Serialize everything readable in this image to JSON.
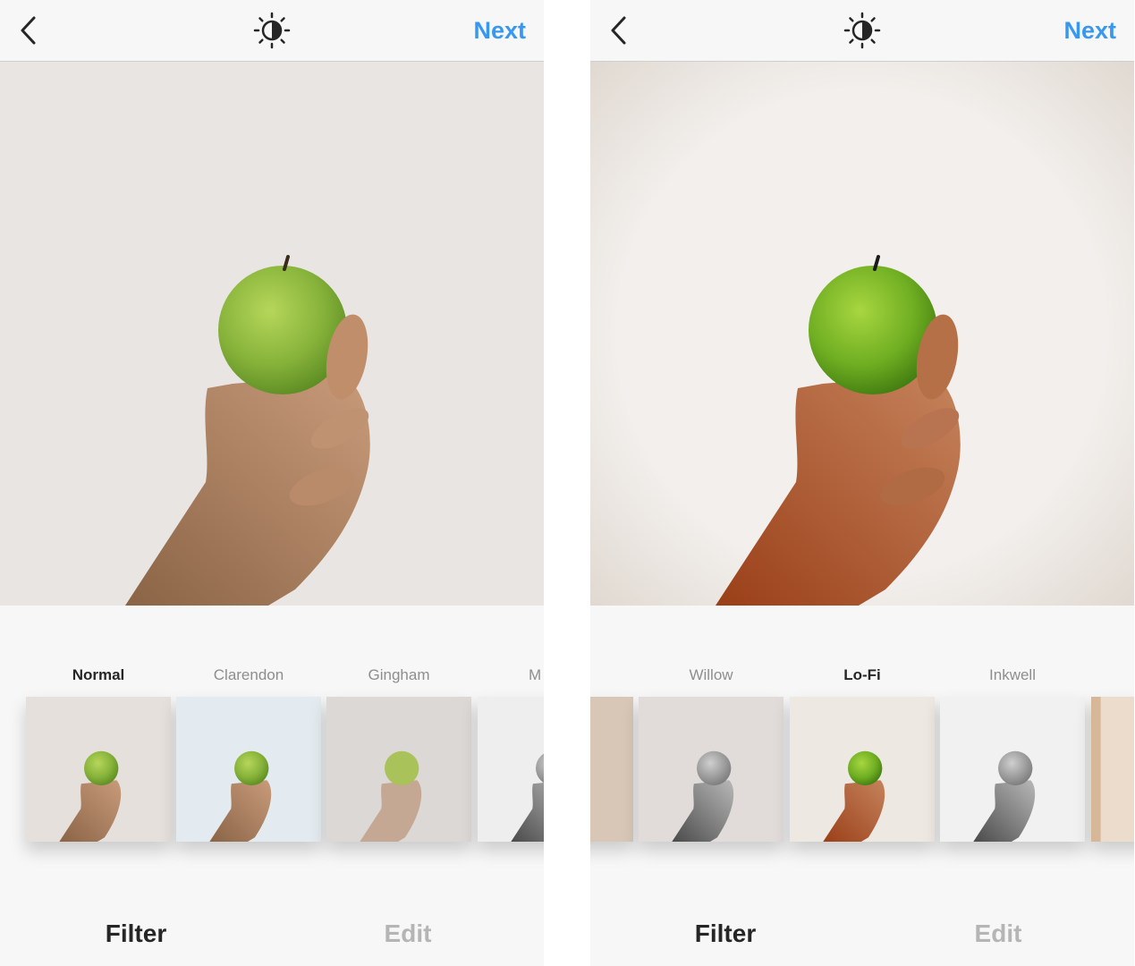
{
  "screens": [
    {
      "header": {
        "back_icon": "chevron-left-icon",
        "lux_icon": "lux-sun-icon",
        "next_label": "Next"
      },
      "filters": [
        {
          "label": "Normal",
          "active": true
        },
        {
          "label": "Clarendon",
          "active": false
        },
        {
          "label": "Gingham",
          "active": false
        },
        {
          "label": "M",
          "active": false
        }
      ],
      "tabs": [
        {
          "label": "Filter",
          "active": true
        },
        {
          "label": "Edit",
          "active": false
        }
      ]
    },
    {
      "header": {
        "back_icon": "chevron-left-icon",
        "lux_icon": "lux-sun-icon",
        "next_label": "Next"
      },
      "filters": [
        {
          "label": "Willow",
          "active": false
        },
        {
          "label": "Lo-Fi",
          "active": true
        },
        {
          "label": "Inkwell",
          "active": false
        }
      ],
      "tabs": [
        {
          "label": "Filter",
          "active": true
        },
        {
          "label": "Edit",
          "active": false
        }
      ]
    }
  ],
  "colors": {
    "accent": "#3897f0",
    "active_text": "#262626",
    "inactive_text": "#8e8e8e",
    "background": "#f7f7f7"
  }
}
